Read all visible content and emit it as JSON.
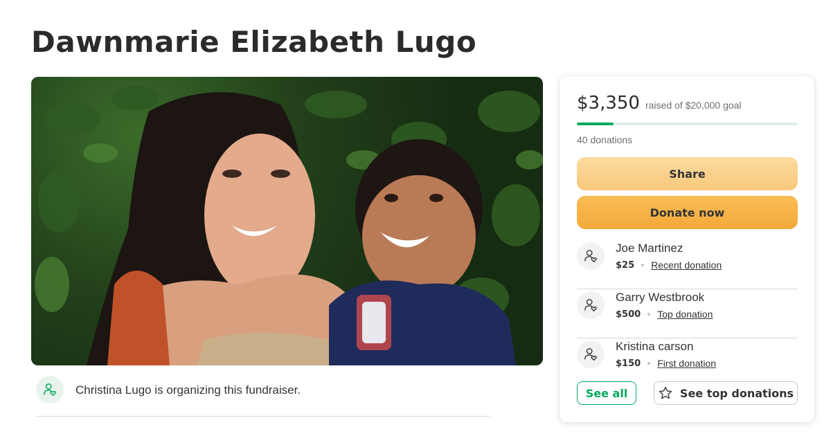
{
  "page": {
    "title": "Dawnmarie Elizabeth Lugo"
  },
  "organizer": {
    "text": "Christina Lugo is organizing this fundraiser.",
    "icon": "user-heart-icon"
  },
  "stats": {
    "raised": "$3,350",
    "goal_text": "raised of $20,000 goal",
    "progress_fraction": 0.1675,
    "donations_count": "40 donations"
  },
  "buttons": {
    "share": "Share",
    "donate": "Donate now",
    "see_all": "See all",
    "see_top": "See top donations"
  },
  "donors": [
    {
      "name": "Joe Martinez",
      "amount": "$25",
      "tag": "Recent donation"
    },
    {
      "name": "Garry Westbrook",
      "amount": "$500",
      "tag": "Top donation"
    },
    {
      "name": "Kristina carson",
      "amount": "$150",
      "tag": "First donation"
    }
  ],
  "colors": {
    "brand_green": "#02a95c",
    "share_button": "#f9d58f",
    "donate_button": "#f5b347",
    "progress_track": "#dff0e6"
  }
}
